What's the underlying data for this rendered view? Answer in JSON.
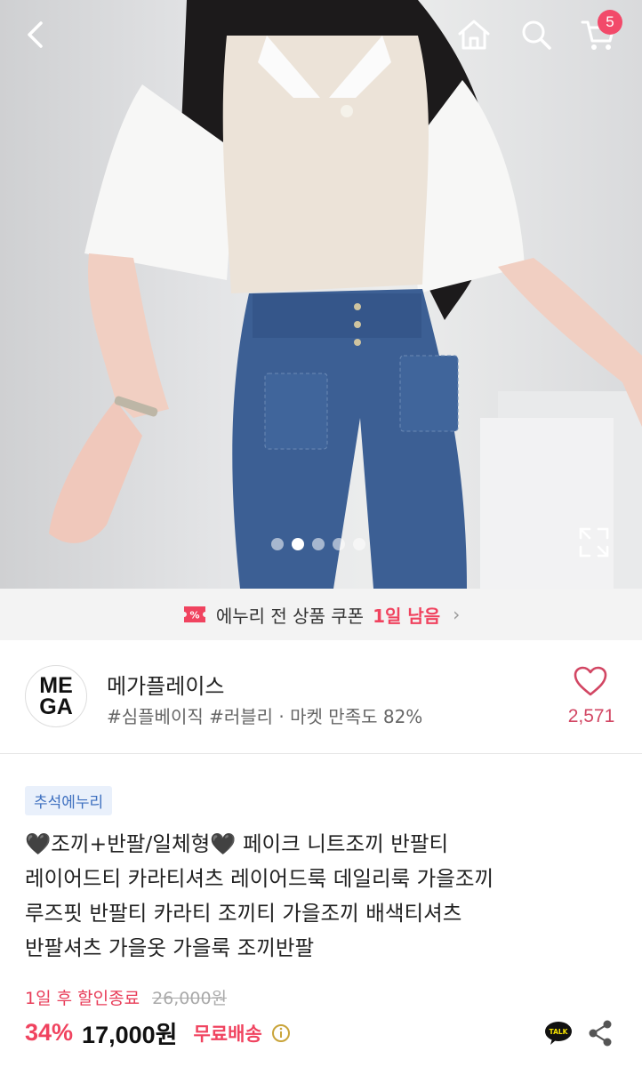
{
  "topbar": {
    "back_icon": "chevron-left-icon",
    "home_icon": "home-icon",
    "search_icon": "search-icon",
    "cart_icon": "cart-icon",
    "cart_count": "5"
  },
  "gallery": {
    "image_count": 5,
    "active_index": 1,
    "expand_icon": "expand-icon"
  },
  "coupon": {
    "text": "에누리 전 상품 쿠폰",
    "highlight": "1일 남음",
    "accent_color": "#f0435f"
  },
  "seller": {
    "logo_line1": "ME",
    "logo_line2": "GA",
    "name": "메가플레이스",
    "tags": "#심플베이직 #러블리 · 마켓 만족도 82%",
    "like_count": "2,571"
  },
  "product": {
    "event_badge": "추석에누리",
    "title": "🖤조끼+반팔/일체형🖤 페이크 니트조끼 반팔티\n레이어드티 카라티셔츠 레이어드룩 데일리룩 가을조끼\n루즈핏 반팔티 카라티 조끼티 가을조끼 배색티셔츠\n반팔셔츠 가을옷 가을룩 조끼반팔",
    "sale_ends": "1일 후 할인종료",
    "original_price": "26,000원",
    "discount": "34%",
    "price": "17,000원",
    "shipping": "무료배송"
  }
}
